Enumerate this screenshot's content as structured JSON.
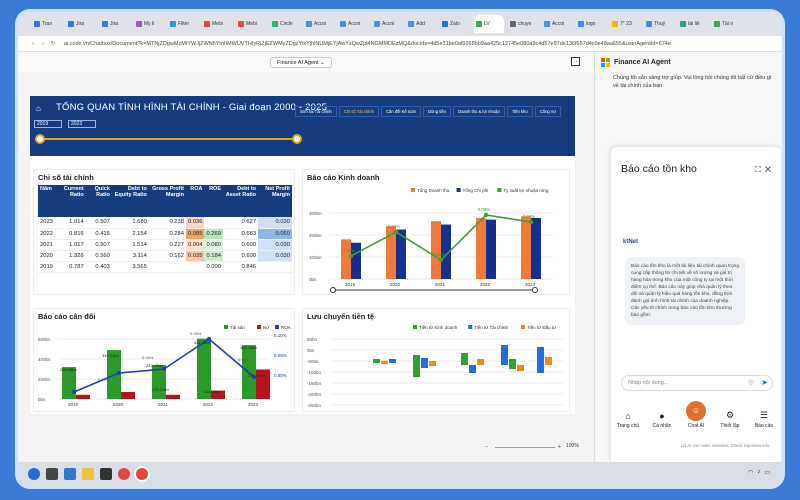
{
  "browser": {
    "tabs": [
      "Tran",
      "Jira",
      "Jira",
      "My li",
      "Filter",
      "Mebi",
      "Mebi",
      "Circle",
      "Accni",
      "Accni",
      "Accni",
      "Add",
      "Zalo",
      "LV",
      "chuye",
      "Accni",
      "logo",
      "7° 23",
      "Thuý",
      "tài liê",
      "Tài n"
    ],
    "url": "ai.codx.vn/Chatbox/Document?k=MTNjZDgwMzMtYWJjZWNhYmItMWUVTHIyRiZjEZWMyZDgzYlxYjhlNUMjEYjAwYzQwZjd4NGMMDEzMQ&docIds=4d5e31be0af9268bb9aa425c12745e080a9c4d57e97de136f657d4c0e48aa655&userAgentId=674e"
  },
  "agent_pill": "Finance AI Agent",
  "report": {
    "title": "TỔNG QUAN TÌNH HÌNH TÀI CHÍNH - Giai đoạn 2000 - 2025",
    "nav": [
      "Sơn tài Tài chính",
      "Chỉ số Tài chính",
      "Cân đối Kế toán",
      "Dòng tiền",
      "Doanh thu & lợi nhuận",
      "Tiền kho",
      "Công nợ"
    ],
    "year_from": "2019",
    "year_to": "2023"
  },
  "kpi": {
    "title": "Chỉ số tài chính",
    "headers": [
      "Năm",
      "Current Ratio",
      "Quick Ratio",
      "Debt to Equity Ratio",
      "Gross Profit Margin",
      "ROA",
      "ROE",
      "Debt to Asset Ratio",
      "Net Profit Margin"
    ],
    "rows": [
      [
        "2023",
        "1.014",
        "0.507",
        "1.680",
        "0.238",
        "0.036",
        "0.627",
        "0.030"
      ],
      [
        "2022",
        "0.816",
        "0.415",
        "2.154",
        "0.284",
        "0.085",
        "0.269",
        "0.683",
        "0.060"
      ],
      [
        "2021",
        "1.017",
        "0.507",
        "1.514",
        "0.227",
        "0.004",
        "0.080",
        "0.600",
        "0.030"
      ],
      [
        "2020",
        "1.326",
        "0.560",
        "3.114",
        "0.162",
        "0.035",
        "0.184",
        "0.600",
        "0.030"
      ],
      [
        "2019",
        "0.787",
        "0.403",
        "3.565",
        "",
        "",
        "0.000",
        "0.846",
        ""
      ]
    ]
  },
  "biz": {
    "title": "Báo cáo Kinh doanh",
    "legend": [
      "Tổng Doanh thu",
      "Tổng Chi phí",
      "Tỷ suất lợi nhuận ròng"
    ],
    "ylabels": [
      "300bn",
      "200bn",
      "100bn",
      "0bn"
    ],
    "pct_labels": [
      "0.00%",
      "0.03%",
      "0.02%",
      "0.06%",
      "0.06%"
    ]
  },
  "balance": {
    "title": "Báo cáo cân đối",
    "legend": [
      "Tài sản",
      "Nợ",
      "ROA"
    ],
    "ylabels": [
      "600bn",
      "400bn",
      "200bn",
      "0bn"
    ],
    "rlabels": [
      "0.10%",
      "0.05%",
      "0.00%"
    ],
    "bar_labels": [
      "228.88bn",
      "349.14bn",
      "243.43bn",
      "431.76bn",
      "385.74bn",
      "211.77bn",
      "171.19bn",
      "113.01bn"
    ],
    "roa_labels": [
      "0.04%",
      "0.04%",
      "0.09%",
      "0.04%"
    ]
  },
  "cash": {
    "title": "Lưu chuyển tiền tệ",
    "legend": [
      "Tiền từ Kinh doanh",
      "Tiền từ Tài chính",
      "Tiền từ Đầu tư"
    ],
    "ylabels": [
      "50bn",
      "0bn",
      "-50bn",
      "-100bn",
      "-150bn",
      "-200bn",
      "-250bn"
    ]
  },
  "years": [
    "2019",
    "2020",
    "2021",
    "2022",
    "2023"
  ],
  "zoom": "100%",
  "right_panel": {
    "title": "Finance AI Agent",
    "greeting": "Chúng tôi sẵn sàng trợ giúp. Vui lòng hỏi chúng tôi bất cứ điều gì về tài chính của bạn",
    "chat_title": "Báo cáo tồn kho",
    "bot_name": "ktNet",
    "bot_message": "Báo cáo tồn kho là một tài liệu tài chính quan trọng cung cấp thông tin chi tiết về số lượng và giá trị hàng hóa trong kho của một công ty tại một thời điểm cụ thể. Báo cáo này giúp nhà quản lý theo dõi và quản lý hiệu quả hàng tồn kho, đồng thời đánh giá tình hình tài chính của doanh nghiệp. Các yếu tố chính trong báo cáo tồn kho thường bao gồm:",
    "input_placeholder": "Nhập nội dung...",
    "nav": [
      "Trang chủ",
      "Cá nhân",
      "Chat AI",
      "Thiết lập",
      "Báo cáo"
    ],
    "footer": "LN AI can make mistakes. Check important info."
  }
}
